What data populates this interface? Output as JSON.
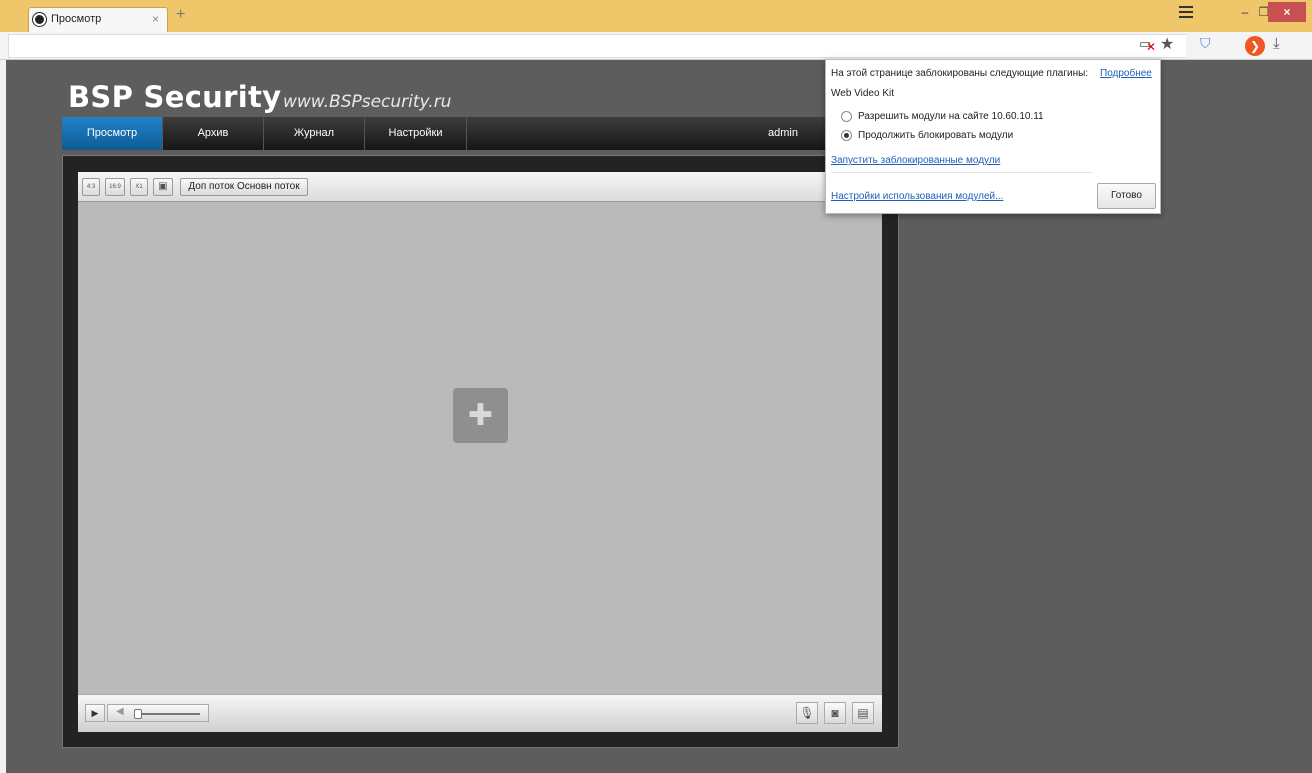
{
  "browser": {
    "tab_title": "Просмотр",
    "tab_close": "×",
    "new_tab": "+",
    "window_controls": {
      "minimize": "–",
      "maximize": "❐",
      "close": "×"
    },
    "address": ""
  },
  "brand": {
    "logo": "BSP Security",
    "url": "www.BSPsecurity.ru"
  },
  "nav": {
    "items": [
      "Просмотр",
      "Архив",
      "Журнал",
      "Настройки"
    ],
    "active": "Просмотр",
    "user": "admin"
  },
  "viewer": {
    "aspect_buttons": [
      "4:3",
      "16:9",
      "X1",
      "▣"
    ],
    "substream": "Доп поток",
    "mainstream": "Основн поток"
  },
  "controls": {
    "play": "▶",
    "volume_level": 0,
    "mic_icon": "microphone-icon",
    "snapshot_icon": "camera-icon",
    "record_icon": "record-icon"
  },
  "plugin_popup": {
    "heading": "На этой странице заблокированы следующие плагины:",
    "details_link": "Подробнее",
    "plugin_name": "Web Video Kit",
    "option_allow": "Разрешить модули на сайте 10.60.10.11",
    "option_block": "Продолжить блокировать модули",
    "selected_option": "option_block",
    "run_link": "Запустить заблокированные модули",
    "settings_link": "Настройки использования модулей...",
    "done_button": "Готово"
  },
  "colors": {
    "titlebar": "#f0c66a",
    "page_bg": "#5d5d5d",
    "nav_active": "#1f83c8",
    "link": "#1f5fb8",
    "close_button": "#c75050"
  }
}
